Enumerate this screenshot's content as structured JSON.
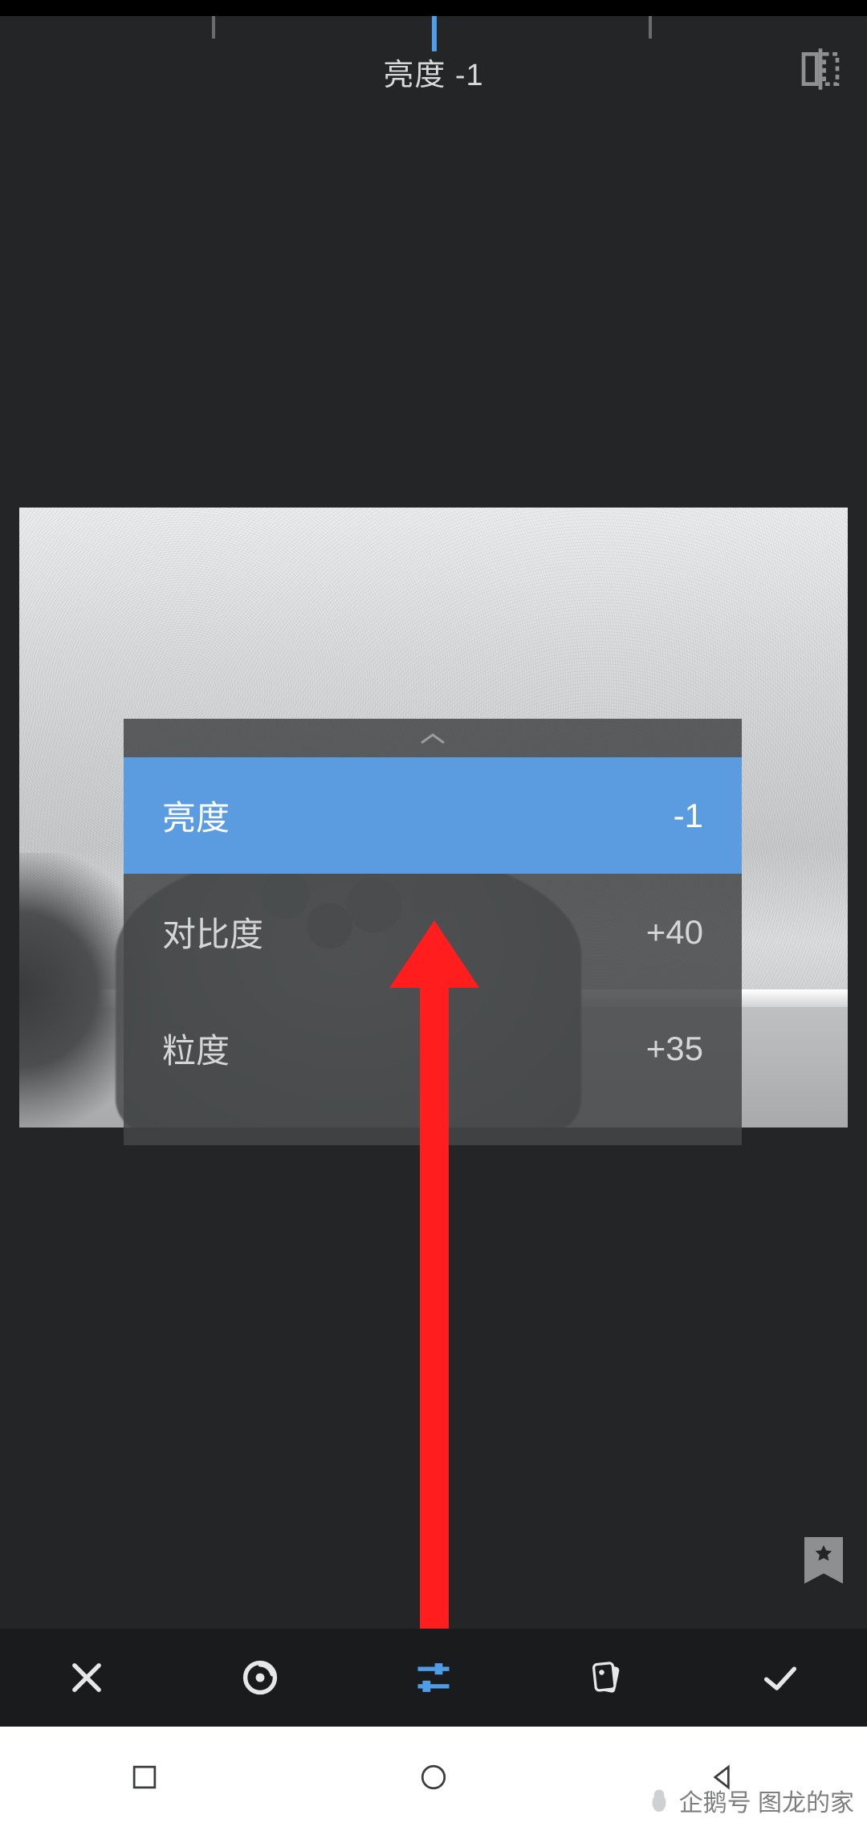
{
  "header": {
    "current_param_label": "亮度 -1"
  },
  "slider": {
    "value": -1,
    "center": 0
  },
  "params": {
    "items": [
      {
        "name": "亮度",
        "value": "-1",
        "active": true
      },
      {
        "name": "对比度",
        "value": "+40",
        "active": false
      },
      {
        "name": "粒度",
        "value": "+35",
        "active": false
      }
    ]
  },
  "icons": {
    "compare": "compare-icon",
    "favorite": "star-bookmark-icon",
    "toolbar": {
      "cancel": "close-icon",
      "auto": "autofix-icon",
      "sliders": "sliders-icon",
      "filters": "filter-card-icon",
      "confirm": "check-icon"
    },
    "nav": {
      "recent": "square-icon",
      "home": "circle-icon",
      "back": "triangle-back-icon"
    }
  },
  "colors": {
    "accent": "#4e9de6",
    "annotation": "#ff1d1d",
    "bg": "#232527",
    "toolbar": "#1a1b1c",
    "popup_active": "#5b9be0"
  },
  "watermark": {
    "text": "企鹅号 图龙的家"
  },
  "annotation": {
    "type": "arrow-up",
    "meaning": "swipe-up-gesture-hint"
  }
}
